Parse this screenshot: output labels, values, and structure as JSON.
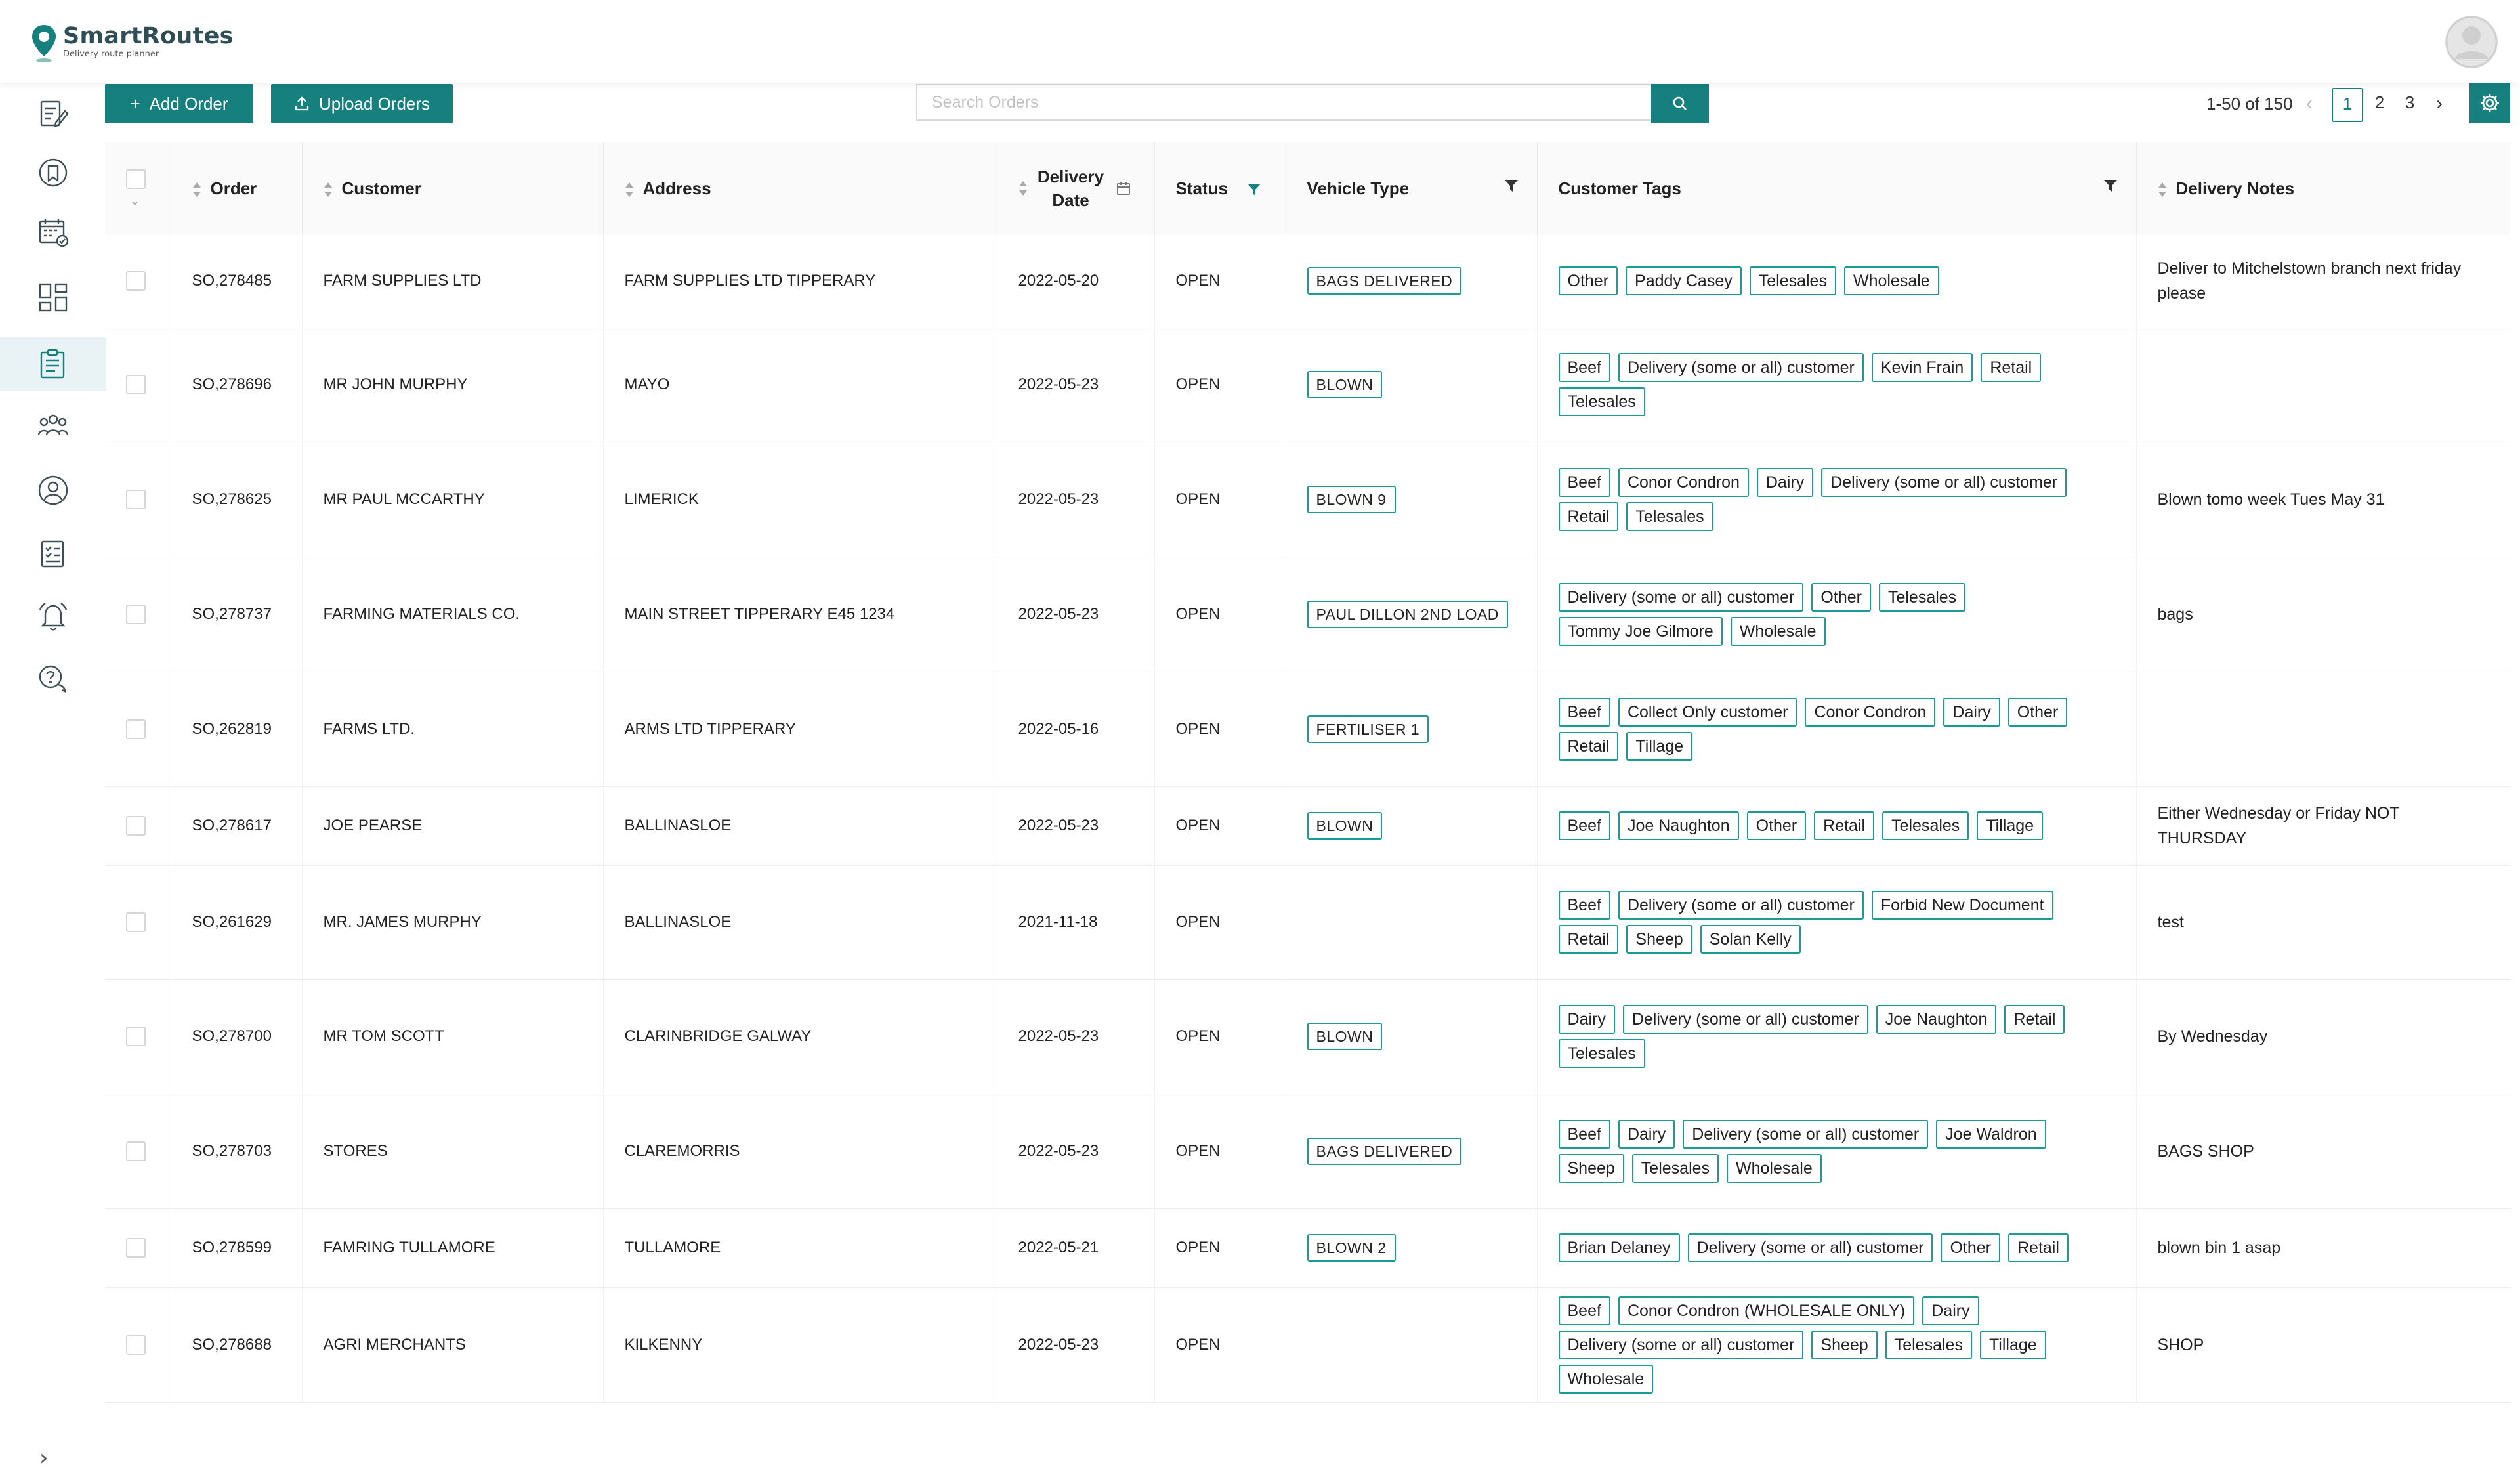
{
  "brand": {
    "name": "SmartRoutes",
    "tagline": "Delivery route planner"
  },
  "toolbar": {
    "add_order": "Add Order",
    "upload_orders": "Upload Orders",
    "search_placeholder": "Search Orders"
  },
  "pagination": {
    "range": "1-50 of 150",
    "pages": [
      "1",
      "2",
      "3"
    ],
    "current": "1"
  },
  "sidebar": {
    "icons": [
      "orders-edit-icon",
      "routes-icon",
      "calendar-icon",
      "dashboard-icon",
      "order-list-icon",
      "team-icon",
      "user-icon",
      "checklist-icon",
      "notifications-icon",
      "support-icon"
    ],
    "active_index": 4
  },
  "table": {
    "headers": {
      "order": "Order",
      "customer": "Customer",
      "address": "Address",
      "delivery_date": "Delivery Date",
      "status": "Status",
      "vehicle_type": "Vehicle Type",
      "customer_tags": "Customer Tags",
      "delivery_notes": "Delivery Notes"
    },
    "rows": [
      {
        "order": "SO,278485",
        "customer": "FARM SUPPLIES LTD",
        "address": "FARM SUPPLIES LTD TIPPERARY",
        "date": "2022-05-20",
        "status": "OPEN",
        "vehicle": "BAGS DELIVERED",
        "tags": [
          "Other",
          "Paddy Casey",
          "Telesales",
          "Wholesale"
        ],
        "notes": "Deliver to Mitchelstown branch next friday please"
      },
      {
        "order": "SO,278696",
        "customer": "MR JOHN MURPHY",
        "address": "MAYO",
        "date": "2022-05-23",
        "status": "OPEN",
        "vehicle": "BLOWN",
        "tags": [
          "Beef",
          "Delivery (some or all) customer",
          "Kevin Frain",
          "Retail",
          "Telesales"
        ],
        "notes": ""
      },
      {
        "order": "SO,278625",
        "customer": "MR PAUL MCCARTHY",
        "address": "LIMERICK",
        "date": "2022-05-23",
        "status": "OPEN",
        "vehicle": "BLOWN 9",
        "tags": [
          "Beef",
          "Conor Condron",
          "Dairy",
          "Delivery (some or all) customer",
          "Retail",
          "Telesales"
        ],
        "notes": "Blown tomo week Tues May 31"
      },
      {
        "order": "SO,278737",
        "customer": "FARMING MATERIALS CO.",
        "address": "MAIN STREET TIPPERARY E45 1234",
        "date": "2022-05-23",
        "status": "OPEN",
        "vehicle": "PAUL DILLON 2ND LOAD",
        "tags": [
          "Delivery (some or all) customer",
          "Other",
          "Telesales",
          "Tommy Joe Gilmore",
          "Wholesale"
        ],
        "notes": "bags"
      },
      {
        "order": "SO,262819",
        "customer": "FARMS LTD.",
        "address": "ARMS LTD TIPPERARY",
        "date": "2022-05-16",
        "status": "OPEN",
        "vehicle": "FERTILISER 1",
        "tags": [
          "Beef",
          "Collect Only customer",
          "Conor Condron",
          "Dairy",
          "Other",
          "Retail",
          "Tillage"
        ],
        "notes": ""
      },
      {
        "order": "SO,278617",
        "customer": "JOE PEARSE",
        "address": "BALLINASLOE",
        "date": "2022-05-23",
        "status": "OPEN",
        "vehicle": "BLOWN",
        "tags": [
          "Beef",
          "Joe Naughton",
          "Other",
          "Retail",
          "Telesales",
          "Tillage"
        ],
        "notes": "Either Wednesday or Friday NOT THURSDAY"
      },
      {
        "order": "SO,261629",
        "customer": "MR. JAMES MURPHY",
        "address": "BALLINASLOE",
        "date": "2021-11-18",
        "status": "OPEN",
        "vehicle": "",
        "tags": [
          "Beef",
          "Delivery (some or all) customer",
          "Forbid New Document",
          "Retail",
          "Sheep",
          "Solan Kelly"
        ],
        "notes": "test"
      },
      {
        "order": "SO,278700",
        "customer": "MR TOM SCOTT",
        "address": "CLARINBRIDGE GALWAY",
        "date": "2022-05-23",
        "status": "OPEN",
        "vehicle": "BLOWN",
        "tags": [
          "Dairy",
          "Delivery (some or all) customer",
          "Joe Naughton",
          "Retail",
          "Telesales"
        ],
        "notes": "By Wednesday"
      },
      {
        "order": "SO,278703",
        "customer": "STORES",
        "address": "CLAREMORRIS",
        "date": "2022-05-23",
        "status": "OPEN",
        "vehicle": "BAGS DELIVERED",
        "tags": [
          "Beef",
          "Dairy",
          "Delivery (some or all) customer",
          "Joe Waldron",
          "Sheep",
          "Telesales",
          "Wholesale"
        ],
        "notes": "BAGS SHOP"
      },
      {
        "order": "SO,278599",
        "customer": "FAMRING TULLAMORE",
        "address": "TULLAMORE",
        "date": "2022-05-21",
        "status": "OPEN",
        "vehicle": "BLOWN 2",
        "tags": [
          "Brian Delaney",
          "Delivery (some or all) customer",
          "Other",
          "Retail"
        ],
        "notes": "blown bin 1 asap"
      },
      {
        "order": "SO,278688",
        "customer": "AGRI MERCHANTS",
        "address": "KILKENNY",
        "date": "2022-05-23",
        "status": "OPEN",
        "vehicle": "",
        "tags": [
          "Beef",
          "Conor Condron (WHOLESALE ONLY)",
          "Dairy",
          "Delivery (some or all) customer",
          "Sheep",
          "Telesales",
          "Tillage",
          "Wholesale"
        ],
        "notes": "SHOP"
      }
    ]
  },
  "colors": {
    "accent": "#16807f",
    "tag_border": "#1e9a96",
    "sidebar_active": "#e9f3f6"
  }
}
